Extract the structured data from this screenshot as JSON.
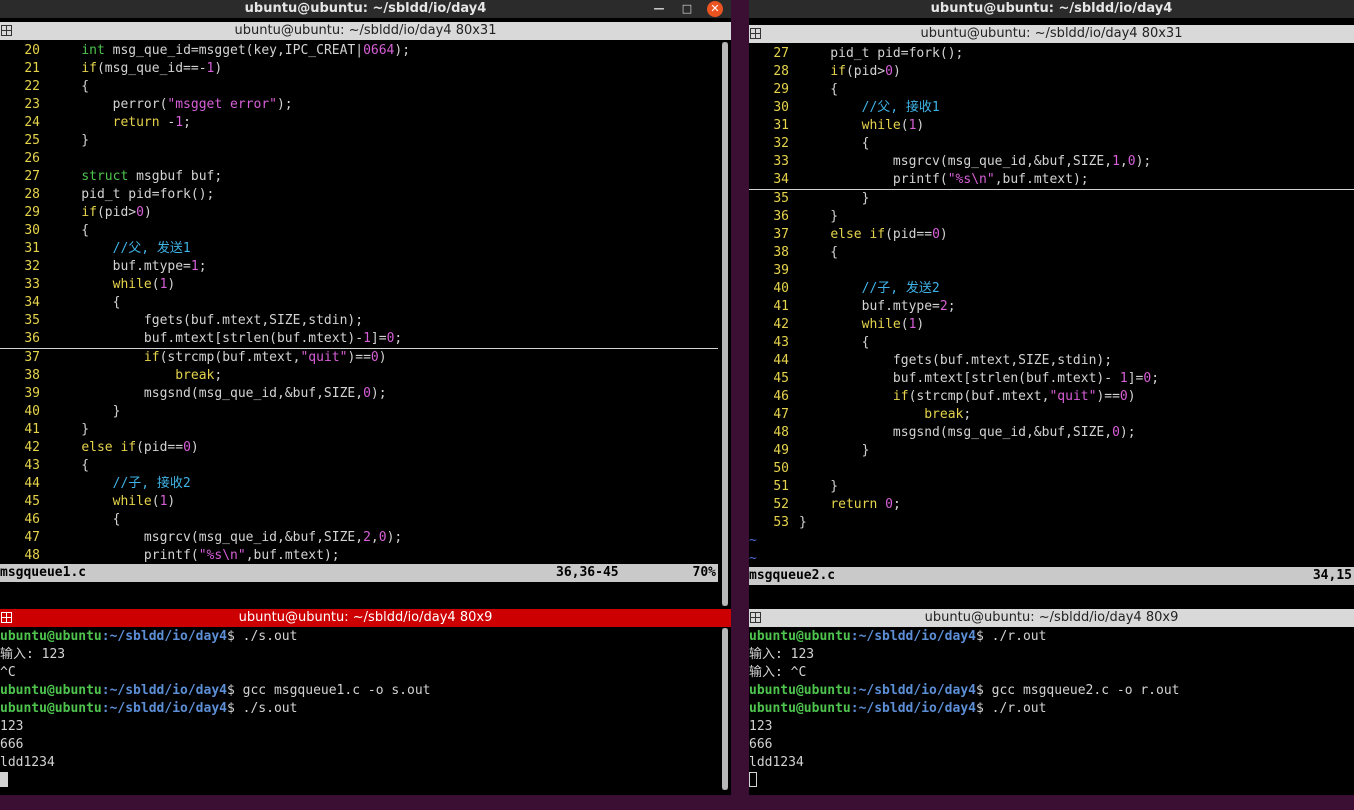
{
  "left_window": {
    "title": "ubuntu@ubuntu: ~/sbldd/io/day4",
    "editor_pane_title": "ubuntu@ubuntu: ~/sbldd/io/day4 80x31",
    "status": {
      "file": "msgqueue1.c",
      "position": "36,36-45",
      "percent": "70%"
    },
    "shell_pane_title": "ubuntu@ubuntu: ~/sbldd/io/day4 80x9",
    "shell_lines": [
      {
        "user": "ubuntu@ubuntu",
        "path": ":~/sbldd/io/day4",
        "cmd": "$ ./s.out"
      },
      {
        "text": "输入: 123"
      },
      {
        "text": "^C"
      },
      {
        "user": "ubuntu@ubuntu",
        "path": ":~/sbldd/io/day4",
        "cmd": "$ gcc msgqueue1.c -o s.out"
      },
      {
        "user": "ubuntu@ubuntu",
        "path": ":~/sbldd/io/day4",
        "cmd": "$ ./s.out"
      },
      {
        "text": "123"
      },
      {
        "text": "666"
      },
      {
        "text": "ldd1234"
      }
    ],
    "code": [
      {
        "n": "20",
        "t": "    int msg_que_id=msgget(key,IPC_CREAT|0664);"
      },
      {
        "n": "21",
        "t": "    if(msg_que_id==-1)"
      },
      {
        "n": "22",
        "t": "    {"
      },
      {
        "n": "23",
        "t": "        perror(\"msgget error\");"
      },
      {
        "n": "24",
        "t": "        return -1;"
      },
      {
        "n": "25",
        "t": "    }"
      },
      {
        "n": "26",
        "t": ""
      },
      {
        "n": "27",
        "t": "    struct msgbuf buf;"
      },
      {
        "n": "28",
        "t": "    pid_t pid=fork();"
      },
      {
        "n": "29",
        "t": "    if(pid>0)"
      },
      {
        "n": "30",
        "t": "    {"
      },
      {
        "n": "31",
        "t": "        //父, 发送1"
      },
      {
        "n": "32",
        "t": "        buf.mtype=1;"
      },
      {
        "n": "33",
        "t": "        while(1)"
      },
      {
        "n": "34",
        "t": "        {"
      },
      {
        "n": "35",
        "t": "            fgets(buf.mtext,SIZE,stdin);"
      },
      {
        "n": "36",
        "t": "            buf.mtext[strlen(buf.mtext)-1]=0;"
      },
      {
        "n": "37",
        "t": "            if(strcmp(buf.mtext,\"quit\")==0)"
      },
      {
        "n": "38",
        "t": "                break;"
      },
      {
        "n": "39",
        "t": "            msgsnd(msg_que_id,&buf,SIZE,0);"
      },
      {
        "n": "40",
        "t": "        }"
      },
      {
        "n": "41",
        "t": "    }"
      },
      {
        "n": "42",
        "t": "    else if(pid==0)"
      },
      {
        "n": "43",
        "t": "    {"
      },
      {
        "n": "44",
        "t": "        //子, 接收2"
      },
      {
        "n": "45",
        "t": "        while(1)"
      },
      {
        "n": "46",
        "t": "        {"
      },
      {
        "n": "47",
        "t": "            msgrcv(msg_que_id,&buf,SIZE,2,0);"
      },
      {
        "n": "48",
        "t": "            printf(\"%s\\n\",buf.mtext);"
      }
    ]
  },
  "right_window": {
    "title": "ubuntu@ubuntu: ~/sbldd/io/day4",
    "editor_pane_title": "ubuntu@ubuntu: ~/sbldd/io/day4 80x31",
    "status": {
      "file": "msgqueue2.c",
      "position": "34,15"
    },
    "shell_pane_title": "ubuntu@ubuntu: ~/sbldd/io/day4 80x9",
    "shell_lines": [
      {
        "user": "ubuntu@ubuntu",
        "path": ":~/sbldd/io/day4",
        "cmd": "$ ./r.out"
      },
      {
        "text": "输入: 123"
      },
      {
        "text": "输入: ^C"
      },
      {
        "user": "ubuntu@ubuntu",
        "path": ":~/sbldd/io/day4",
        "cmd": "$ gcc msgqueue2.c -o r.out"
      },
      {
        "user": "ubuntu@ubuntu",
        "path": ":~/sbldd/io/day4",
        "cmd": "$ ./r.out"
      },
      {
        "text": "123"
      },
      {
        "text": "666"
      },
      {
        "text": "ldd1234"
      }
    ],
    "code": [
      {
        "n": "27",
        "t": "    pid_t pid=fork();"
      },
      {
        "n": "28",
        "t": "    if(pid>0)"
      },
      {
        "n": "29",
        "t": "    {"
      },
      {
        "n": "30",
        "t": "        //父, 接收1"
      },
      {
        "n": "31",
        "t": "        while(1)"
      },
      {
        "n": "32",
        "t": "        {"
      },
      {
        "n": "33",
        "t": "            msgrcv(msg_que_id,&buf,SIZE,1,0);"
      },
      {
        "n": "34",
        "t": "            printf(\"%s\\n\",buf.mtext);"
      },
      {
        "n": "35",
        "t": "        }"
      },
      {
        "n": "36",
        "t": "    }"
      },
      {
        "n": "37",
        "t": "    else if(pid==0)"
      },
      {
        "n": "38",
        "t": "    {"
      },
      {
        "n": "39",
        "t": ""
      },
      {
        "n": "40",
        "t": "        //子, 发送2"
      },
      {
        "n": "41",
        "t": "        buf.mtype=2;"
      },
      {
        "n": "42",
        "t": "        while(1)"
      },
      {
        "n": "43",
        "t": "        {"
      },
      {
        "n": "44",
        "t": "            fgets(buf.mtext,SIZE,stdin);"
      },
      {
        "n": "45",
        "t": "            buf.mtext[strlen(buf.mtext)- 1]=0;"
      },
      {
        "n": "46",
        "t": "            if(strcmp(buf.mtext,\"quit\")==0)"
      },
      {
        "n": "47",
        "t": "                break;"
      },
      {
        "n": "48",
        "t": "            msgsnd(msg_que_id,&buf,SIZE,0);"
      },
      {
        "n": "49",
        "t": "        }"
      },
      {
        "n": "50",
        "t": ""
      },
      {
        "n": "51",
        "t": "    }"
      },
      {
        "n": "52",
        "t": "    return 0;"
      },
      {
        "n": "53",
        "t": "}"
      },
      {
        "n": "~",
        "t": ""
      },
      {
        "n": "~",
        "t": ""
      }
    ]
  },
  "icons": {
    "minimize": "minimize-icon",
    "maximize": "maximize-icon",
    "close": "close-icon",
    "split": "split-pane-icon"
  }
}
